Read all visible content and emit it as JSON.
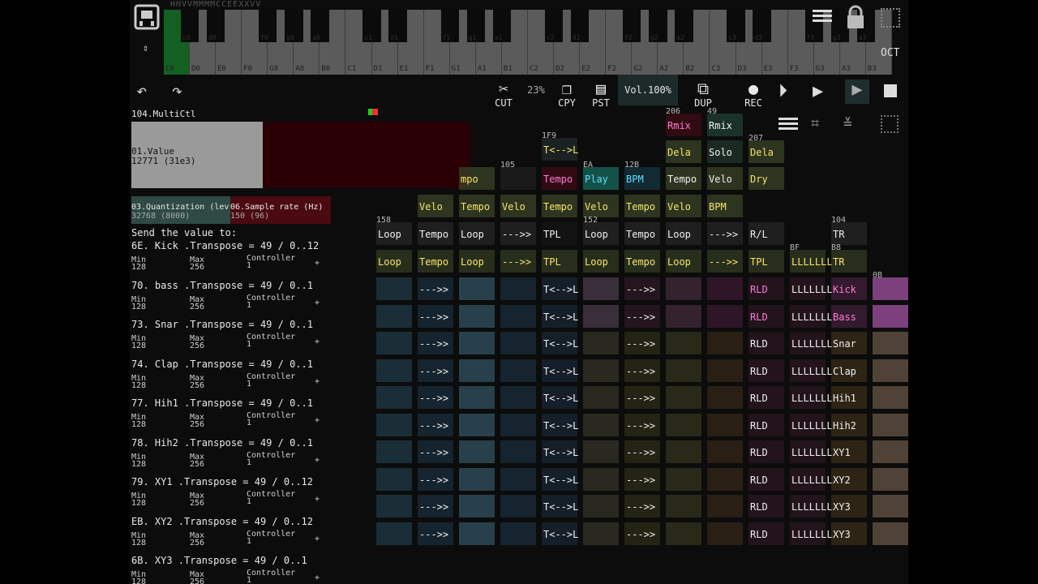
{
  "top_letters": "HHVVMMMMCCEEXXVV",
  "keyboard": {
    "white_keys": [
      "C0",
      "D0",
      "E0",
      "F0",
      "G0",
      "A0",
      "B0",
      "C1",
      "D1",
      "E1",
      "F1",
      "G1",
      "A1",
      "B1",
      "C2",
      "D2",
      "E2",
      "F2",
      "G2",
      "A2",
      "B2",
      "C3",
      "D3",
      "E3",
      "F3",
      "G3",
      "A3",
      "B3"
    ],
    "black_keys": [
      "c0",
      "d0",
      "f0",
      "g0",
      "a0",
      "c1",
      "d1",
      "f1",
      "g1",
      "a1",
      "c2",
      "d2",
      "f2",
      "g2",
      "a2",
      "c3",
      "d3",
      "f3",
      "g3",
      "a3"
    ],
    "active_key": "C0"
  },
  "toolbar": {
    "cut": "CUT",
    "zoom": "23%",
    "copy": "CPY",
    "paste": "PST",
    "volume": "Vol.100%",
    "dup": "DUP",
    "rec": "REC",
    "oct": "OCT"
  },
  "left_panel": {
    "module_title": "104.MultiCtl",
    "value_name": "01.Value",
    "value_num": "12771 (31e3)",
    "ctl_a_name": "03.Quantization (lev",
    "ctl_a_value": "32768 (8000)",
    "ctl_b_name": "06.Sample rate (Hz)",
    "ctl_b_value": "150 (96)",
    "send_label": "Send the value to:",
    "targets": [
      {
        "id": "6E.",
        "name": "Kick",
        "param": ".Transpose = 49 / 0..12"
      },
      {
        "id": "70.",
        "name": "bass",
        "param": ".Transpose = 49 / 0..1"
      },
      {
        "id": "73.",
        "name": "Snar",
        "param": ".Transpose = 49 / 0..1"
      },
      {
        "id": "74.",
        "name": "Clap",
        "param": ".Transpose = 49 / 0..1"
      },
      {
        "id": "77.",
        "name": "Hih1",
        "param": ".Transpose = 49 / 0..1"
      },
      {
        "id": "78.",
        "name": "Hih2",
        "param": ".Transpose = 49 / 0..1"
      },
      {
        "id": "79.",
        "name": "XY1",
        "param": ".Transpose = 49 / 0..12"
      },
      {
        "id": "EB.",
        "name": "XY2",
        "param": ".Transpose = 49 / 0..12"
      },
      {
        "id": "6B.",
        "name": "XY3",
        "param": ".Transpose = 49 / 0..1"
      }
    ],
    "min_label": "Min",
    "min_val": "128",
    "max_label": "Max",
    "max_val": "256",
    "ctrl_label": "Controller",
    "ctrl_val": "1",
    "plus": "+"
  },
  "grid": {
    "top_labels": [
      {
        "n": "206",
        "t": "Rmix"
      },
      {
        "n": "49",
        "t": "Rmix"
      },
      {
        "n": "1F9",
        "t": "T<-->L"
      },
      {
        "n": "",
        "t": "Dela"
      },
      {
        "n": "",
        "t": "Solo"
      },
      {
        "n": "207",
        "t": "Dela"
      },
      {
        "n": "105",
        "t": ""
      },
      {
        "n": "EA",
        "t": "Play"
      },
      {
        "n": "12B",
        "t": "BPM"
      },
      {
        "n": "",
        "t": "mpo"
      },
      {
        "n": "",
        "t": "Tempo"
      },
      {
        "n": "",
        "t": "Tempo"
      },
      {
        "n": "",
        "t": "Velo"
      },
      {
        "n": "",
        "t": "Dry"
      },
      {
        "n": "",
        "t": "Velo"
      },
      {
        "n": "",
        "t": "Tempo"
      },
      {
        "n": "",
        "t": "Velo"
      },
      {
        "n": "",
        "t": "Tempo"
      },
      {
        "n": "",
        "t": "Velo"
      },
      {
        "n": "",
        "t": "Tempo"
      },
      {
        "n": "",
        "t": "Velo"
      },
      {
        "n": "",
        "t": "BPM"
      },
      {
        "n": "158",
        "t": "Loop"
      },
      {
        "n": "",
        "t": "Tempo"
      },
      {
        "n": "",
        "t": "Loop"
      },
      {
        "n": "",
        "t": "--->>"
      },
      {
        "n": "",
        "t": "TPL"
      },
      {
        "n": "152",
        "t": "Loop"
      },
      {
        "n": "",
        "t": "Tempo"
      },
      {
        "n": "",
        "t": "Loop"
      },
      {
        "n": "",
        "t": "--->>"
      },
      {
        "n": "",
        "t": "R/L"
      },
      {
        "n": "104",
        "t": "TR"
      },
      {
        "n": "",
        "t": "Loop"
      },
      {
        "n": "",
        "t": "Tempo"
      },
      {
        "n": "",
        "t": "Loop"
      },
      {
        "n": "",
        "t": "--->>"
      },
      {
        "n": "",
        "t": "TPL"
      },
      {
        "n": "",
        "t": "Loop"
      },
      {
        "n": "",
        "t": "Tempo"
      },
      {
        "n": "",
        "t": "Loop"
      },
      {
        "n": "",
        "t": "--->>"
      },
      {
        "n": "",
        "t": "TPL"
      },
      {
        "n": "BF",
        "t": "LLLLLLL"
      },
      {
        "n": "B8",
        "t": "TR"
      }
    ],
    "row_arrow": "--->>",
    "row_tl": "T<-->L",
    "row_rld": "RLD",
    "row_lll": "LLLLLLL",
    "track_names": [
      "Kick",
      "Bass",
      "Snar",
      "Clap",
      "Hih1",
      "Hih2",
      "XY1",
      "XY2",
      "XY3",
      "XY3"
    ],
    "extra_label": "0B"
  }
}
